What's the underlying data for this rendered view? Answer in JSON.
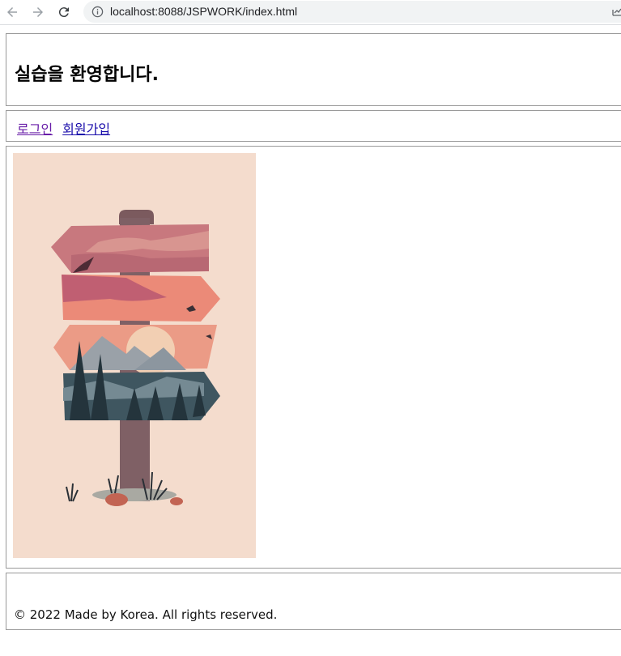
{
  "browser": {
    "url": "localhost:8088/JSPWORK/index.html",
    "icons": [
      "back-arrow-icon",
      "forward-arrow-icon",
      "reload-icon",
      "info-icon",
      "share-icon"
    ]
  },
  "header": {
    "title": "실습을 환영합니다."
  },
  "nav": {
    "login": "로그인",
    "signup": "회원가입"
  },
  "main": {
    "image": "signpost-illustration"
  },
  "footer": {
    "copyright": "© 2022 Made by Korea. All rights reserved."
  },
  "colors": {
    "link": "#1a0dab",
    "visited_link": "#681da8",
    "border": "#999999",
    "illustration_bg": "#f4dccd"
  }
}
